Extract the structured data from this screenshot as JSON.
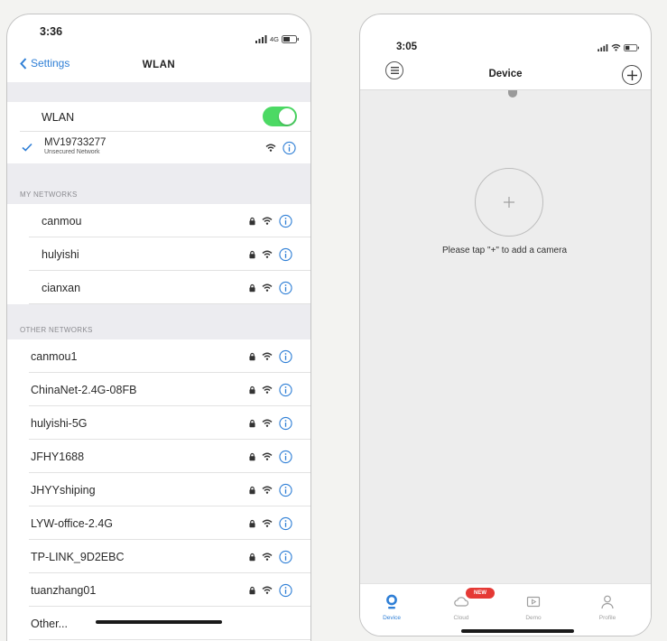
{
  "left_phone": {
    "status_bar": {
      "time": "3:36",
      "network": "4G"
    },
    "nav": {
      "back_label": "Settings",
      "title": "WLAN"
    },
    "wlan": {
      "label": "WLAN",
      "enabled": true
    },
    "connected_network": {
      "ssid": "MV19733277",
      "security": "Unsecured Network"
    },
    "my_networks": {
      "header": "MY NETWORKS",
      "items": [
        {
          "ssid": "canmou",
          "locked": true
        },
        {
          "ssid": "hulyishi",
          "locked": true
        },
        {
          "ssid": "cianxan",
          "locked": true
        }
      ]
    },
    "other_networks": {
      "header": "OTHER NETWORKS",
      "items": [
        {
          "ssid": "canmou1",
          "locked": true
        },
        {
          "ssid": "ChinaNet-2.4G-08FB",
          "locked": true
        },
        {
          "ssid": "hulyishi-5G",
          "locked": true
        },
        {
          "ssid": "JFHY1688",
          "locked": true
        },
        {
          "ssid": "JHYYshiping",
          "locked": true
        },
        {
          "ssid": "LYW-office-2.4G",
          "locked": true
        },
        {
          "ssid": "TP-LINK_9D2EBC",
          "locked": true
        },
        {
          "ssid": "tuanzhang01",
          "locked": true
        }
      ],
      "other_label": "Other..."
    }
  },
  "right_phone": {
    "status_bar": {
      "time": "3:05"
    },
    "nav": {
      "title": "Device",
      "left_icon": "menu-icon",
      "right_icon": "add-icon"
    },
    "empty_state": {
      "message": "Please tap \"+\" to add a camera"
    },
    "tab_bar": {
      "tabs": [
        {
          "label": "Device",
          "icon": "device-icon",
          "active": true
        },
        {
          "label": "Cloud",
          "icon": "cloud-icon",
          "badge": "NEW"
        },
        {
          "label": "Demo",
          "icon": "demo-icon"
        },
        {
          "label": "Profile",
          "icon": "profile-icon"
        }
      ]
    }
  },
  "colors": {
    "accent": "#2f7fd6",
    "toggle_on": "#4cd964",
    "badge": "#e53935"
  }
}
